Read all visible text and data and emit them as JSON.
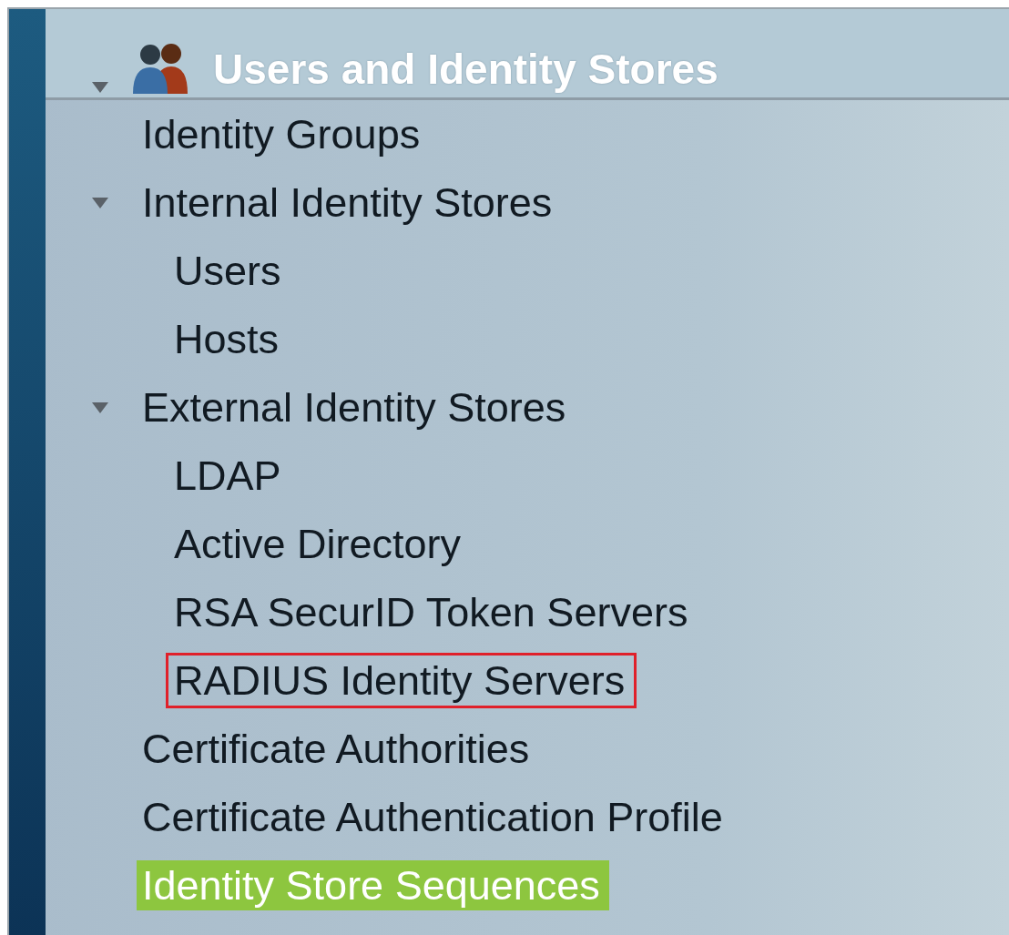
{
  "header": {
    "title": "Users and Identity Stores",
    "expanded": true
  },
  "items": [
    {
      "label": "Identity Groups",
      "selected": false,
      "outlined": false
    },
    {
      "label": "Internal Identity Stores",
      "selected": false,
      "outlined": false,
      "expanded": true,
      "children": [
        {
          "label": "Users",
          "selected": false,
          "outlined": false
        },
        {
          "label": "Hosts",
          "selected": false,
          "outlined": false
        }
      ]
    },
    {
      "label": "External Identity Stores",
      "selected": false,
      "outlined": false,
      "expanded": true,
      "children": [
        {
          "label": "LDAP",
          "selected": false,
          "outlined": false
        },
        {
          "label": "Active Directory",
          "selected": false,
          "outlined": false
        },
        {
          "label": "RSA SecurID Token Servers",
          "selected": false,
          "outlined": false
        },
        {
          "label": "RADIUS Identity Servers",
          "selected": false,
          "outlined": true
        }
      ]
    },
    {
      "label": "Certificate Authorities",
      "selected": false,
      "outlined": false
    },
    {
      "label": "Certificate Authentication Profile",
      "selected": false,
      "outlined": false
    },
    {
      "label": "Identity Store Sequences",
      "selected": true,
      "outlined": false
    }
  ]
}
